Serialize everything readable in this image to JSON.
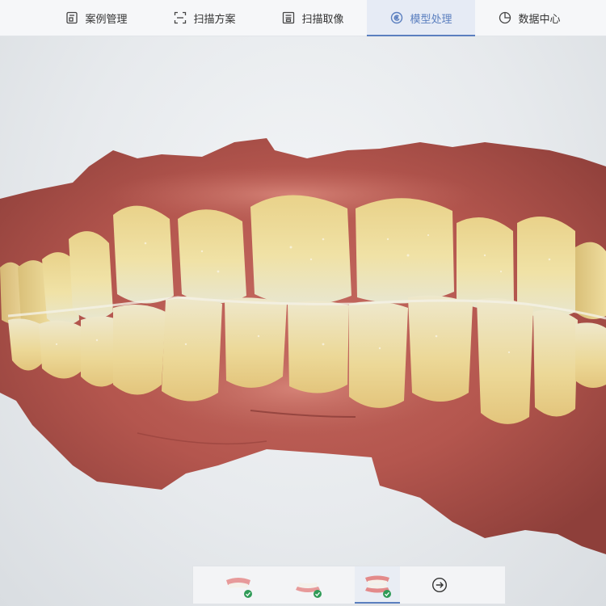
{
  "nav": {
    "tabs": [
      {
        "label": "案例管理",
        "icon": "case-management-icon"
      },
      {
        "label": "扫描方案",
        "icon": "scan-frame-icon"
      },
      {
        "label": "扫描取像",
        "icon": "scan-capture-icon"
      },
      {
        "label": "模型处理",
        "icon": "model-process-icon",
        "active": true
      },
      {
        "label": "数据中心",
        "icon": "pie-chart-icon"
      }
    ],
    "accent_color": "#5b7fbf"
  },
  "viewport": {
    "content": "3D intraoral scan model of upper and lower teeth in occlusion"
  },
  "model_selector": {
    "items": [
      {
        "name": "upper-jaw",
        "completed": true,
        "active": false
      },
      {
        "name": "lower-jaw",
        "completed": true,
        "active": false
      },
      {
        "name": "bite-occlusion",
        "completed": true,
        "active": true
      }
    ],
    "next_icon": "arrow-right-circle-icon",
    "check_color": "#2f9b57"
  }
}
